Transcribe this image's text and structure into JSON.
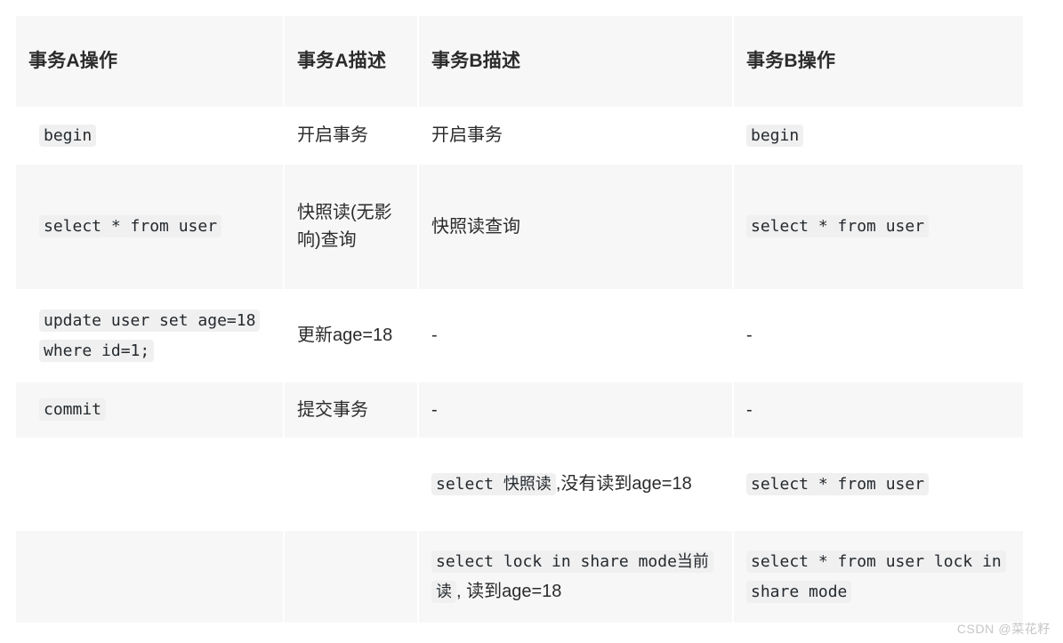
{
  "table": {
    "headers": [
      "事务A操作",
      "事务A描述",
      "事务B描述",
      "事务B操作"
    ],
    "rows": [
      {
        "a_op_code": "begin",
        "a_desc": "开启事务",
        "b_desc": "开启事务",
        "b_op_code": "begin"
      },
      {
        "a_op_code": "select * from user",
        "a_desc": "快照读(无影响)查询",
        "b_desc": "快照读查询",
        "b_op_code": "select * from user"
      },
      {
        "a_op_code": "update user set age=18 where id=1;",
        "a_desc": "更新age=18",
        "b_desc": "-",
        "b_op_code": "-"
      },
      {
        "a_op_code": "commit",
        "a_desc": "提交事务",
        "b_desc": "-",
        "b_op_code": "-"
      },
      {
        "a_op_code": "",
        "a_desc": "",
        "b_desc_code": "select 快照读",
        "b_desc_tail": ",没有读到age=18",
        "b_op_code": "select * from user"
      },
      {
        "a_op_code": "",
        "a_desc": "",
        "b_desc_code": "select lock in share mode当前读",
        "b_desc_tail": ", 读到age=18",
        "b_op_code": "select * from user lock in share mode"
      }
    ]
  },
  "watermark": "CSDN @菜花籽"
}
